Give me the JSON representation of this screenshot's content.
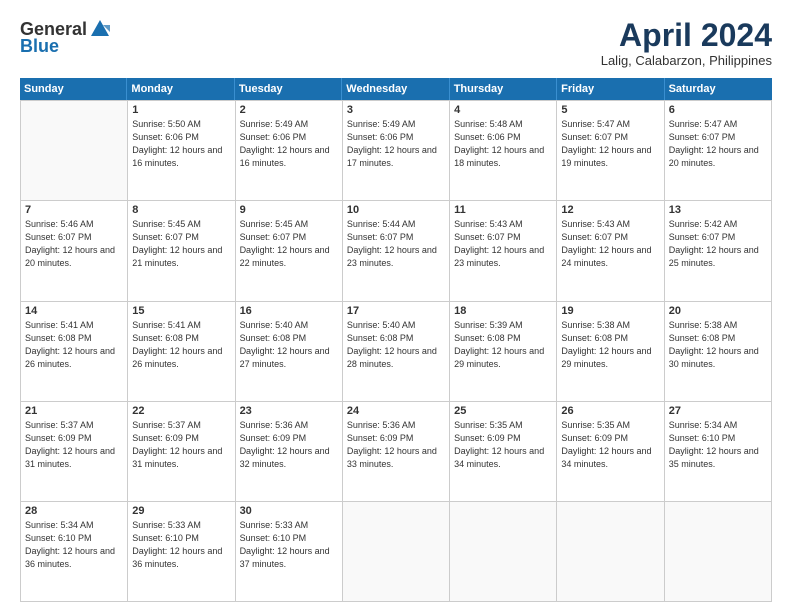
{
  "header": {
    "logo_general": "General",
    "logo_blue": "Blue",
    "title": "April 2024",
    "location": "Lalig, Calabarzon, Philippines"
  },
  "weekdays": [
    "Sunday",
    "Monday",
    "Tuesday",
    "Wednesday",
    "Thursday",
    "Friday",
    "Saturday"
  ],
  "weeks": [
    [
      {
        "day": "",
        "sunrise": "",
        "sunset": "",
        "daylight": ""
      },
      {
        "day": "1",
        "sunrise": "Sunrise: 5:50 AM",
        "sunset": "Sunset: 6:06 PM",
        "daylight": "Daylight: 12 hours and 16 minutes."
      },
      {
        "day": "2",
        "sunrise": "Sunrise: 5:49 AM",
        "sunset": "Sunset: 6:06 PM",
        "daylight": "Daylight: 12 hours and 16 minutes."
      },
      {
        "day": "3",
        "sunrise": "Sunrise: 5:49 AM",
        "sunset": "Sunset: 6:06 PM",
        "daylight": "Daylight: 12 hours and 17 minutes."
      },
      {
        "day": "4",
        "sunrise": "Sunrise: 5:48 AM",
        "sunset": "Sunset: 6:06 PM",
        "daylight": "Daylight: 12 hours and 18 minutes."
      },
      {
        "day": "5",
        "sunrise": "Sunrise: 5:47 AM",
        "sunset": "Sunset: 6:07 PM",
        "daylight": "Daylight: 12 hours and 19 minutes."
      },
      {
        "day": "6",
        "sunrise": "Sunrise: 5:47 AM",
        "sunset": "Sunset: 6:07 PM",
        "daylight": "Daylight: 12 hours and 20 minutes."
      }
    ],
    [
      {
        "day": "7",
        "sunrise": "Sunrise: 5:46 AM",
        "sunset": "Sunset: 6:07 PM",
        "daylight": "Daylight: 12 hours and 20 minutes."
      },
      {
        "day": "8",
        "sunrise": "Sunrise: 5:45 AM",
        "sunset": "Sunset: 6:07 PM",
        "daylight": "Daylight: 12 hours and 21 minutes."
      },
      {
        "day": "9",
        "sunrise": "Sunrise: 5:45 AM",
        "sunset": "Sunset: 6:07 PM",
        "daylight": "Daylight: 12 hours and 22 minutes."
      },
      {
        "day": "10",
        "sunrise": "Sunrise: 5:44 AM",
        "sunset": "Sunset: 6:07 PM",
        "daylight": "Daylight: 12 hours and 23 minutes."
      },
      {
        "day": "11",
        "sunrise": "Sunrise: 5:43 AM",
        "sunset": "Sunset: 6:07 PM",
        "daylight": "Daylight: 12 hours and 23 minutes."
      },
      {
        "day": "12",
        "sunrise": "Sunrise: 5:43 AM",
        "sunset": "Sunset: 6:07 PM",
        "daylight": "Daylight: 12 hours and 24 minutes."
      },
      {
        "day": "13",
        "sunrise": "Sunrise: 5:42 AM",
        "sunset": "Sunset: 6:07 PM",
        "daylight": "Daylight: 12 hours and 25 minutes."
      }
    ],
    [
      {
        "day": "14",
        "sunrise": "Sunrise: 5:41 AM",
        "sunset": "Sunset: 6:08 PM",
        "daylight": "Daylight: 12 hours and 26 minutes."
      },
      {
        "day": "15",
        "sunrise": "Sunrise: 5:41 AM",
        "sunset": "Sunset: 6:08 PM",
        "daylight": "Daylight: 12 hours and 26 minutes."
      },
      {
        "day": "16",
        "sunrise": "Sunrise: 5:40 AM",
        "sunset": "Sunset: 6:08 PM",
        "daylight": "Daylight: 12 hours and 27 minutes."
      },
      {
        "day": "17",
        "sunrise": "Sunrise: 5:40 AM",
        "sunset": "Sunset: 6:08 PM",
        "daylight": "Daylight: 12 hours and 28 minutes."
      },
      {
        "day": "18",
        "sunrise": "Sunrise: 5:39 AM",
        "sunset": "Sunset: 6:08 PM",
        "daylight": "Daylight: 12 hours and 29 minutes."
      },
      {
        "day": "19",
        "sunrise": "Sunrise: 5:38 AM",
        "sunset": "Sunset: 6:08 PM",
        "daylight": "Daylight: 12 hours and 29 minutes."
      },
      {
        "day": "20",
        "sunrise": "Sunrise: 5:38 AM",
        "sunset": "Sunset: 6:08 PM",
        "daylight": "Daylight: 12 hours and 30 minutes."
      }
    ],
    [
      {
        "day": "21",
        "sunrise": "Sunrise: 5:37 AM",
        "sunset": "Sunset: 6:09 PM",
        "daylight": "Daylight: 12 hours and 31 minutes."
      },
      {
        "day": "22",
        "sunrise": "Sunrise: 5:37 AM",
        "sunset": "Sunset: 6:09 PM",
        "daylight": "Daylight: 12 hours and 31 minutes."
      },
      {
        "day": "23",
        "sunrise": "Sunrise: 5:36 AM",
        "sunset": "Sunset: 6:09 PM",
        "daylight": "Daylight: 12 hours and 32 minutes."
      },
      {
        "day": "24",
        "sunrise": "Sunrise: 5:36 AM",
        "sunset": "Sunset: 6:09 PM",
        "daylight": "Daylight: 12 hours and 33 minutes."
      },
      {
        "day": "25",
        "sunrise": "Sunrise: 5:35 AM",
        "sunset": "Sunset: 6:09 PM",
        "daylight": "Daylight: 12 hours and 34 minutes."
      },
      {
        "day": "26",
        "sunrise": "Sunrise: 5:35 AM",
        "sunset": "Sunset: 6:09 PM",
        "daylight": "Daylight: 12 hours and 34 minutes."
      },
      {
        "day": "27",
        "sunrise": "Sunrise: 5:34 AM",
        "sunset": "Sunset: 6:10 PM",
        "daylight": "Daylight: 12 hours and 35 minutes."
      }
    ],
    [
      {
        "day": "28",
        "sunrise": "Sunrise: 5:34 AM",
        "sunset": "Sunset: 6:10 PM",
        "daylight": "Daylight: 12 hours and 36 minutes."
      },
      {
        "day": "29",
        "sunrise": "Sunrise: 5:33 AM",
        "sunset": "Sunset: 6:10 PM",
        "daylight": "Daylight: 12 hours and 36 minutes."
      },
      {
        "day": "30",
        "sunrise": "Sunrise: 5:33 AM",
        "sunset": "Sunset: 6:10 PM",
        "daylight": "Daylight: 12 hours and 37 minutes."
      },
      {
        "day": "",
        "sunrise": "",
        "sunset": "",
        "daylight": ""
      },
      {
        "day": "",
        "sunrise": "",
        "sunset": "",
        "daylight": ""
      },
      {
        "day": "",
        "sunrise": "",
        "sunset": "",
        "daylight": ""
      },
      {
        "day": "",
        "sunrise": "",
        "sunset": "",
        "daylight": ""
      }
    ]
  ]
}
